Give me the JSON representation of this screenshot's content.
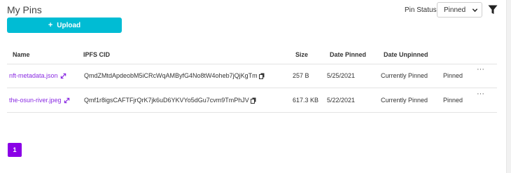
{
  "header": {
    "title": "My Pins",
    "upload_label": "Upload",
    "pin_status_label": "Pin Status",
    "pin_status_selected": "Pinned"
  },
  "table": {
    "columns": [
      "Name",
      "IPFS CID",
      "Size",
      "Date Pinned",
      "Date Unpinned"
    ],
    "rows": [
      {
        "name": "nft-metadata.json",
        "cid": "QmdZMtdApdeobM5iCRcWqAMByfG4No8tW4oheb7jQjKgTm",
        "size": "257 B",
        "date_pinned": "5/25/2021",
        "date_unpinned": "Currently Pinned",
        "status": "Pinned",
        "menu": "···"
      },
      {
        "name": "the-osun-river.jpeg",
        "cid": "Qmf1r8igsCAFTFjrQrK7jk6uD6YKVYo5dGu7cvm9TmPhJV",
        "size": "617.3 KB",
        "date_pinned": "5/22/2021",
        "date_unpinned": "Currently Pinned",
        "status": "Pinned",
        "menu": "···"
      }
    ]
  },
  "pagination": {
    "current_page": "1"
  },
  "colors": {
    "accent": "#00bcd4",
    "link": "#8a2be2",
    "page_active": "#8a00e6"
  },
  "icons": {
    "upload": "plus-icon",
    "filter": "filter-icon",
    "expand": "expand-arrow-icon",
    "copy": "copy-icon",
    "dropdown": "chevron-down-icon",
    "row_menu": "more-dots-icon"
  }
}
